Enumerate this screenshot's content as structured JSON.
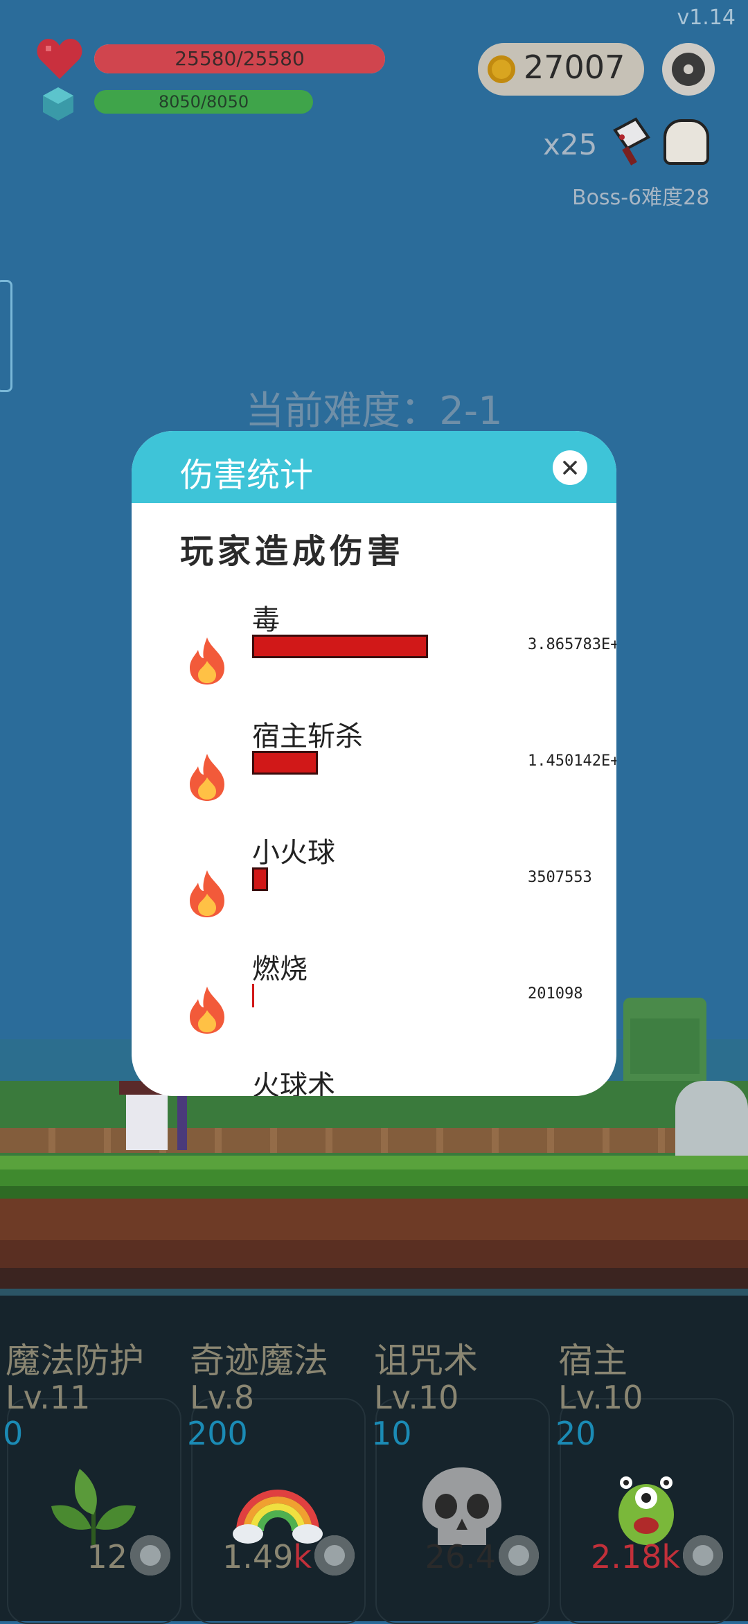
{
  "hud": {
    "version": "v1.14",
    "hp": "25580/25580",
    "mp": "8050/8050",
    "coins": "27007",
    "multiplier": "x25",
    "boss": "Boss-6难度28"
  },
  "stage": {
    "difficulty": "当前难度：2-1"
  },
  "modal": {
    "title": "伤害统计",
    "section": "玩家造成伤害",
    "rows": [
      {
        "name": "毒",
        "value": "3.865783E+",
        "share": 1.0
      },
      {
        "name": "宿主斩杀",
        "value": "1.450142E+",
        "share": 0.375
      },
      {
        "name": "小火球",
        "value": "3507553",
        "share": 0.09
      },
      {
        "name": "燃烧",
        "value": "201098",
        "share": 0.005
      },
      {
        "name": "火球术",
        "value": "",
        "share": 0
      }
    ]
  },
  "skills": [
    {
      "title": "魔法防护",
      "level": "Lv.11",
      "cost": "0",
      "count": "12",
      "count_unit": "",
      "icon": "leaf-icon"
    },
    {
      "title": "奇迹魔法",
      "level": "Lv.8",
      "cost": "200",
      "count": "1.49",
      "count_unit": "k",
      "icon": "rainbow-icon"
    },
    {
      "title": "诅咒术",
      "level": "Lv.10",
      "cost": "10",
      "count": "26.4",
      "count_unit": "",
      "icon": "skull-icon"
    },
    {
      "title": "宿主",
      "level": "Lv.10",
      "cost": "20",
      "count": "2.18",
      "count_unit": "k",
      "icon": "monster-icon"
    }
  ],
  "colors": {
    "modal_header": "#3ec4d8",
    "damage_bar": "#d11818",
    "hp_fill": "#d0454e",
    "mp_fill": "#3fa44a",
    "cost_text": "#1b8bb5"
  }
}
